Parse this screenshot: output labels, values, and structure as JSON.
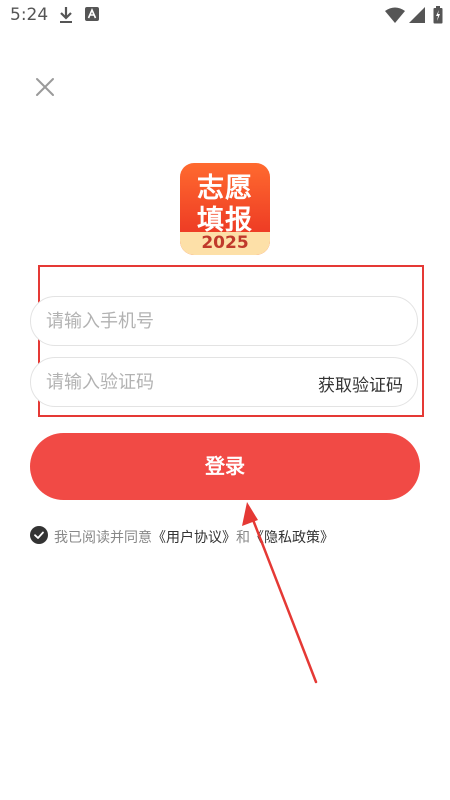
{
  "status_bar": {
    "time": "5:24"
  },
  "logo": {
    "line1": "志愿",
    "line2": "填报",
    "year": "2025"
  },
  "login_form": {
    "phone_placeholder": "请输入手机号",
    "code_placeholder": "请输入验证码",
    "get_code_label": "获取验证码",
    "login_label": "登录"
  },
  "agreement": {
    "prefix": "我已阅读并同意",
    "user_agreement": "《用户协议》",
    "conjunction": "和",
    "privacy_policy": "《隐私政策》"
  },
  "colors": {
    "primary": "#f14a45",
    "annotation": "#e53935"
  }
}
